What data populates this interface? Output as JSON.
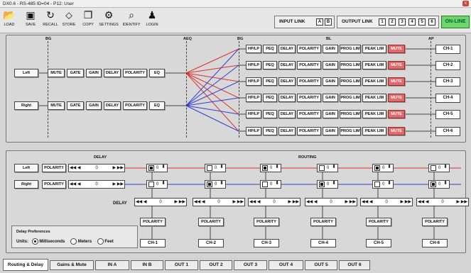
{
  "window": {
    "title": "DX0.6 - RS-485 ID=04 - P12: User",
    "close": "x"
  },
  "toolbar": {
    "items": [
      {
        "label": "LOAD",
        "icon": "folder-icon"
      },
      {
        "label": "SAVE",
        "icon": "save-icon"
      },
      {
        "label": "RECALL",
        "icon": "recall-icon"
      },
      {
        "label": "STORE",
        "icon": "store-icon"
      },
      {
        "label": "COPY",
        "icon": "copy-icon"
      },
      {
        "label": "SETTINGS",
        "icon": "gear-icon"
      },
      {
        "label": "IDENTIFY",
        "icon": "identify-icon"
      },
      {
        "label": "LOGIN",
        "icon": "users-icon"
      }
    ],
    "input_link": {
      "label": "INPUT LINK",
      "buttons": [
        "A",
        "B"
      ]
    },
    "output_link": {
      "label": "OUTPUT LINK",
      "buttons": [
        "1",
        "2",
        "3",
        "4",
        "5",
        "6"
      ]
    },
    "online": "ON-LINE"
  },
  "top": {
    "headers": {
      "bg1": "BG",
      "aeq": "AEQ",
      "bg2": "BG",
      "bl": "BL",
      "ap": "AP"
    },
    "inputs": [
      {
        "name": "Left",
        "chain": [
          "MUTE",
          "GATE",
          "GAIN",
          "DELAY",
          "POLARITY",
          "EQ"
        ]
      },
      {
        "name": "Right",
        "chain": [
          "MUTE",
          "GATE",
          "GAIN",
          "DELAY",
          "POLARITY",
          "EQ"
        ]
      }
    ],
    "output_chain": [
      "HP/LP",
      "PEQ",
      "DELAY",
      "POLARITY",
      "GAIN",
      "PROG LIM",
      "PEAK LIM",
      "MUTE"
    ],
    "outputs": [
      "CH-1",
      "CH-2",
      "CH-3",
      "CH-4",
      "CH-5",
      "CH-6"
    ]
  },
  "bottom": {
    "delay_title": "DELAY",
    "routing_title": "ROUTING",
    "inputs": [
      {
        "name": "Left",
        "polarity": "POLARITY",
        "delay": "0"
      },
      {
        "name": "Right",
        "polarity": "POLARITY",
        "delay": "0"
      }
    ],
    "routing_left": [
      {
        "on": true,
        "value": "0"
      },
      {
        "on": false,
        "value": "0"
      },
      {
        "on": true,
        "value": "0"
      },
      {
        "on": false,
        "value": "0"
      },
      {
        "on": true,
        "value": "0"
      },
      {
        "on": false,
        "value": "0"
      }
    ],
    "routing_right": [
      {
        "on": false,
        "value": "0"
      },
      {
        "on": true,
        "value": "0"
      },
      {
        "on": false,
        "value": "0"
      },
      {
        "on": true,
        "value": "0"
      },
      {
        "on": false,
        "value": "0"
      },
      {
        "on": true,
        "value": "0"
      }
    ],
    "delay_label": "DELAY",
    "out_delays": [
      "0",
      "0",
      "0",
      "0",
      "0",
      "0"
    ],
    "polarity": "POLARITY",
    "channels": [
      "CH-1",
      "CH-2",
      "CH-3",
      "CH-4",
      "CH-5",
      "CH-6"
    ],
    "prefs": {
      "title": "Delay Preferences",
      "units_label": "Units:",
      "options": [
        "Milliseconds",
        "Meters",
        "Feet"
      ],
      "selected": "Milliseconds"
    }
  },
  "tabs": [
    "Routing & Delay",
    "Gains & Mute",
    "IN A",
    "IN B",
    "OUT 1",
    "OUT 2",
    "OUT 3",
    "OUT 4",
    "OUT 5",
    "OUT 6"
  ],
  "active_tab": "Routing & Delay",
  "colors": {
    "left_line": "#e03030",
    "right_line": "#3040d0",
    "mute_red": "#e36a6a",
    "online_green": "#6cd66c"
  }
}
